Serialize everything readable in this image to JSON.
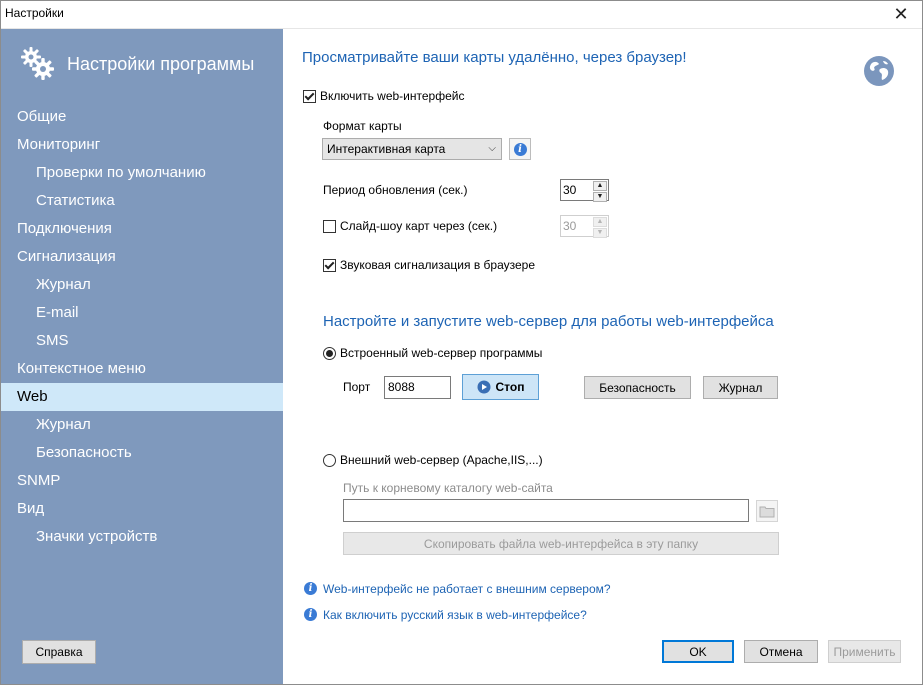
{
  "window": {
    "title": "Настройки",
    "close_glyph": "✕"
  },
  "sidebar": {
    "title": "Настройки программы",
    "items": [
      {
        "label": "Общие",
        "level": 0
      },
      {
        "label": "Мониторинг",
        "level": 0
      },
      {
        "label": "Проверки по умолчанию",
        "level": 1
      },
      {
        "label": "Статистика",
        "level": 1
      },
      {
        "label": "Подключения",
        "level": 0
      },
      {
        "label": "Сигнализация",
        "level": 0
      },
      {
        "label": "Журнал",
        "level": 1
      },
      {
        "label": "E-mail",
        "level": 1
      },
      {
        "label": "SMS",
        "level": 1
      },
      {
        "label": "Контекстное меню",
        "level": 0
      },
      {
        "label": "Web",
        "level": 0,
        "selected": true
      },
      {
        "label": "Журнал",
        "level": 1
      },
      {
        "label": "Безопасность",
        "level": 1
      },
      {
        "label": "SNMP",
        "level": 0
      },
      {
        "label": "Вид",
        "level": 0
      },
      {
        "label": "Значки устройств",
        "level": 1
      }
    ],
    "help_label": "Справка"
  },
  "main": {
    "heading": "Просматривайте ваши карты удалённо, через браузер!",
    "enable_web": {
      "label": "Включить web-интерфейс",
      "checked": true
    },
    "map_format": {
      "label": "Формат карты",
      "value": "Интерактивная карта"
    },
    "refresh_period": {
      "label": "Период обновления (сек.)",
      "value": "30"
    },
    "slideshow": {
      "label": "Слайд-шоу карт через (сек.)",
      "checked": false,
      "value": "30"
    },
    "sound_alarm": {
      "label": "Звуковая сигнализация в браузере",
      "checked": true
    },
    "server_heading": "Настройте и запустите web-сервер для работы web-интерфейса",
    "builtin_server": {
      "label": "Встроенный web-сервер программы",
      "selected": true
    },
    "port": {
      "label": "Порт",
      "value": "8088"
    },
    "stop_label": "Стоп",
    "security_label": "Безопасность",
    "journal_label": "Журнал",
    "external_server": {
      "label": "Внешний web-сервер (Apache,IIS,...)",
      "selected": false
    },
    "root_path": {
      "label": "Путь к корневому каталогу web-сайта",
      "value": ""
    },
    "copy_files_label": "Скопировать файла web-интерфейса в эту папку",
    "help_links": [
      "Web-интерфейс не работает с внешним сервером?",
      "Как включить русский язык в web-интерфейсе?"
    ]
  },
  "footer": {
    "ok": "OK",
    "cancel": "Отмена",
    "apply": "Применить"
  },
  "colors": {
    "sidebar_bg": "#7f99bd",
    "selected_bg": "#cfe8f9",
    "accent": "#1e64b4"
  }
}
